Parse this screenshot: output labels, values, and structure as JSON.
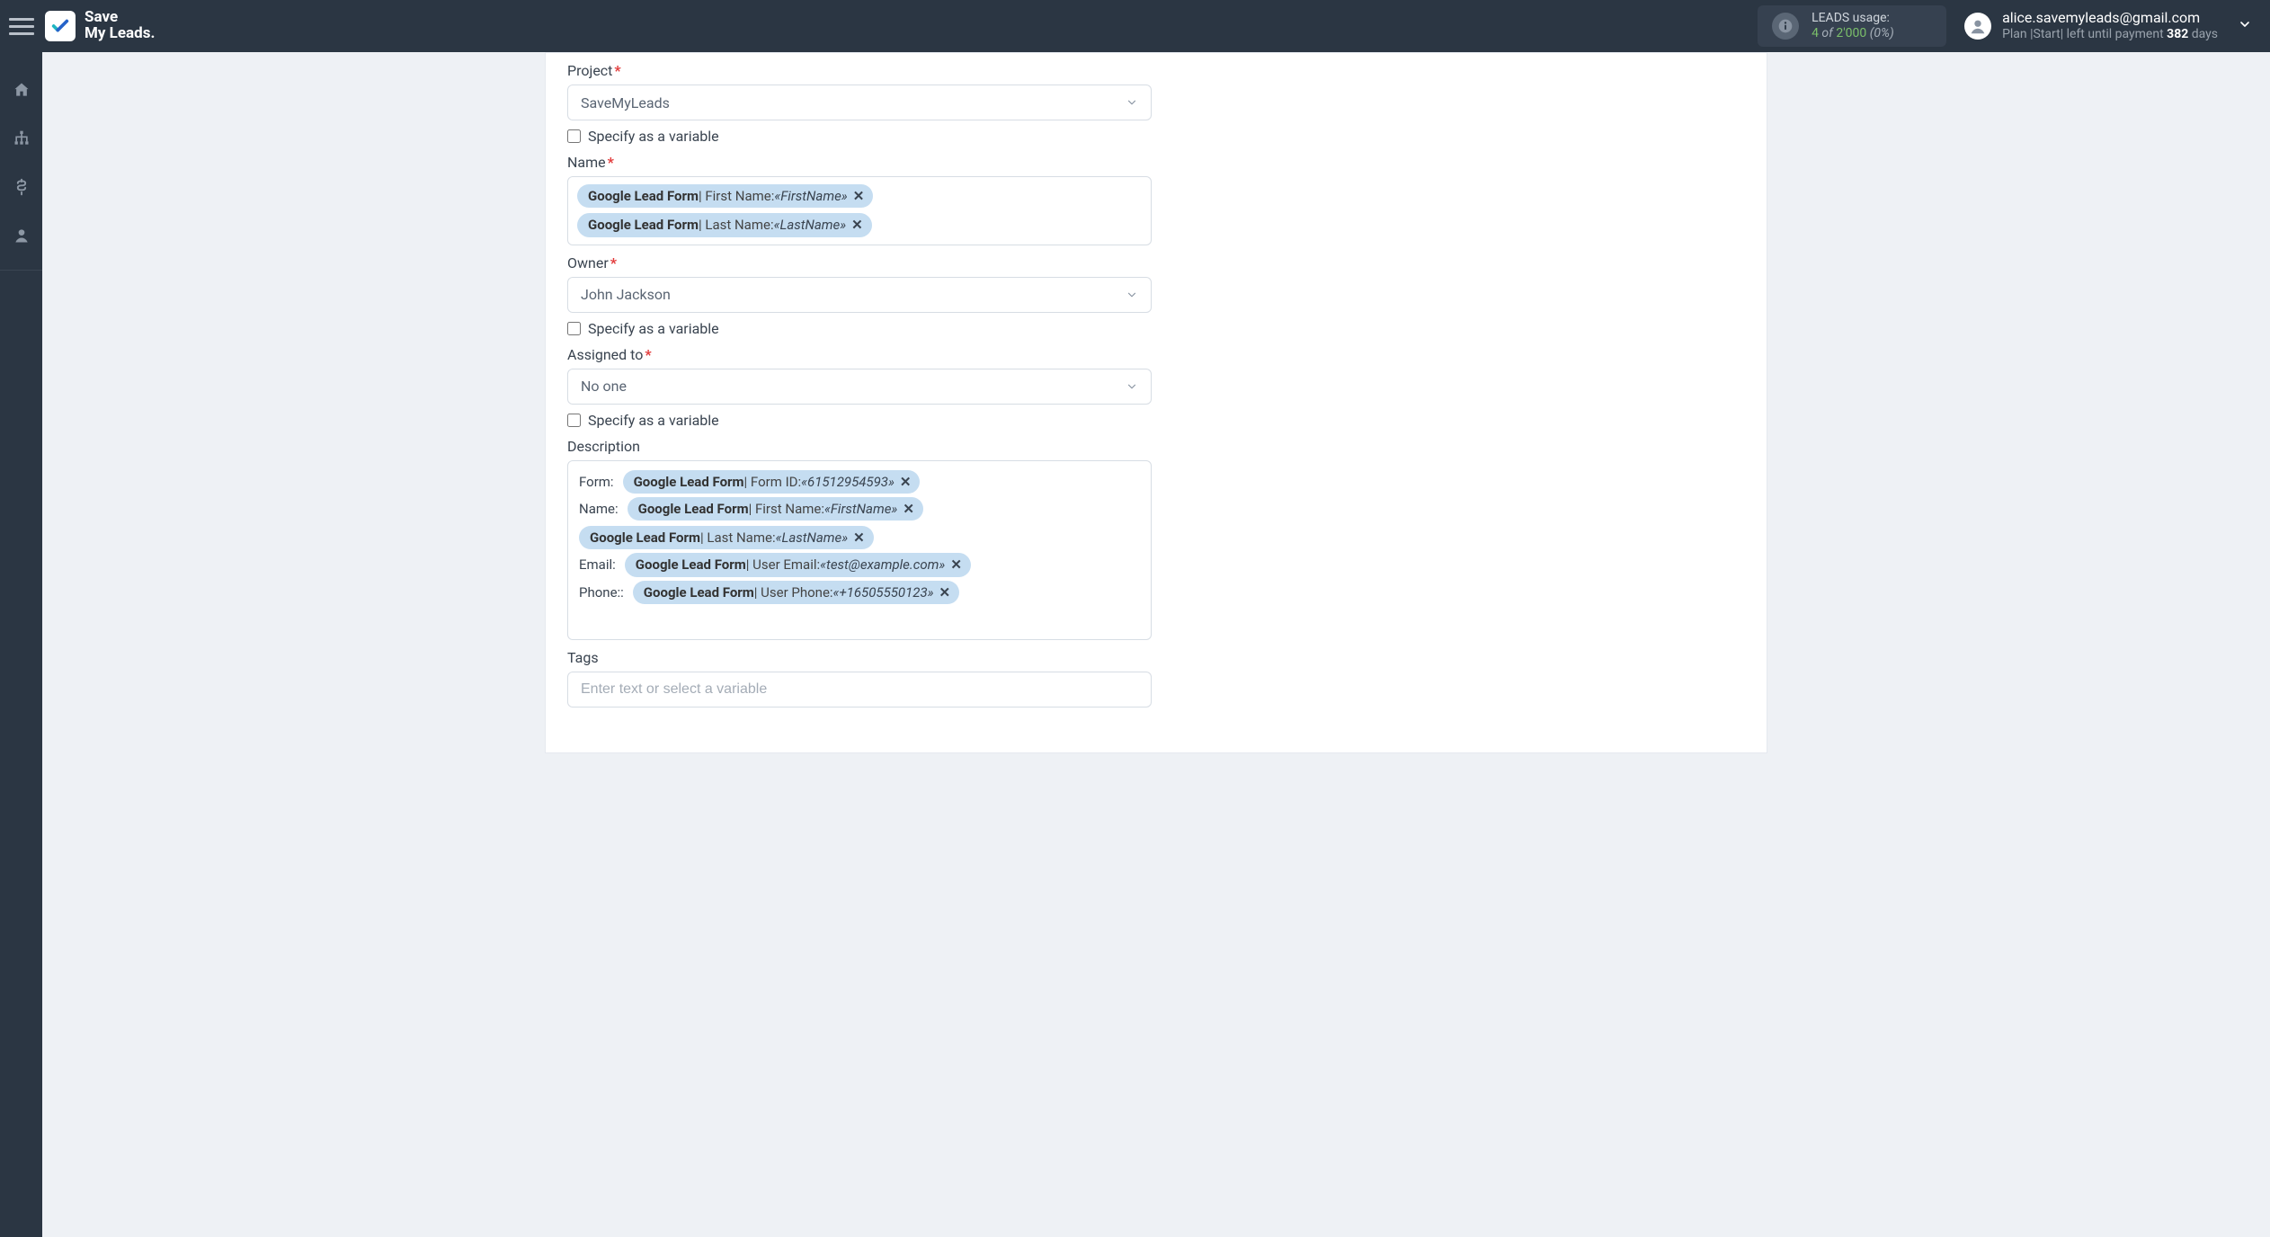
{
  "brand": {
    "line1": "Save",
    "line2": "My Leads."
  },
  "header": {
    "usage": {
      "title": "LEADS usage:",
      "used": "4",
      "of_word": "of",
      "total": "2'000",
      "pct": "(0%)"
    },
    "account": {
      "email": "alice.savemyleads@gmail.com",
      "plan_prefix": "Plan |Start| left until payment ",
      "days": "382",
      "days_suffix": " days"
    }
  },
  "form": {
    "project": {
      "label": "Project",
      "value": "SaveMyLeads",
      "specify_label": "Specify as a variable"
    },
    "name": {
      "label": "Name",
      "tokens": [
        {
          "src": "Google Lead Form",
          "field": "First Name",
          "value": "«FirstName»"
        },
        {
          "src": "Google Lead Form",
          "field": "Last Name",
          "value": "«LastName»"
        }
      ]
    },
    "owner": {
      "label": "Owner",
      "value": "John Jackson",
      "specify_label": "Specify as a variable"
    },
    "assigned": {
      "label": "Assigned to",
      "value": "No one",
      "specify_label": "Specify as a variable"
    },
    "description": {
      "label": "Description",
      "rows": [
        {
          "label": "Form:",
          "tokens": [
            {
              "src": "Google Lead Form",
              "field": "Form ID",
              "value": "«61512954593»"
            }
          ]
        },
        {
          "label": "Name:",
          "tokens": [
            {
              "src": "Google Lead Form",
              "field": "First Name",
              "value": "«FirstName»"
            },
            {
              "src": "Google Lead Form",
              "field": "Last Name",
              "value": "«LastName»"
            }
          ]
        },
        {
          "label": "Email:",
          "tokens": [
            {
              "src": "Google Lead Form",
              "field": "User Email",
              "value": "«test@example.com»"
            }
          ]
        },
        {
          "label": "Phone::",
          "tokens": [
            {
              "src": "Google Lead Form",
              "field": "User Phone",
              "value": "«+16505550123»"
            }
          ]
        }
      ]
    },
    "tags": {
      "label": "Tags",
      "placeholder": "Enter text or select a variable"
    }
  }
}
